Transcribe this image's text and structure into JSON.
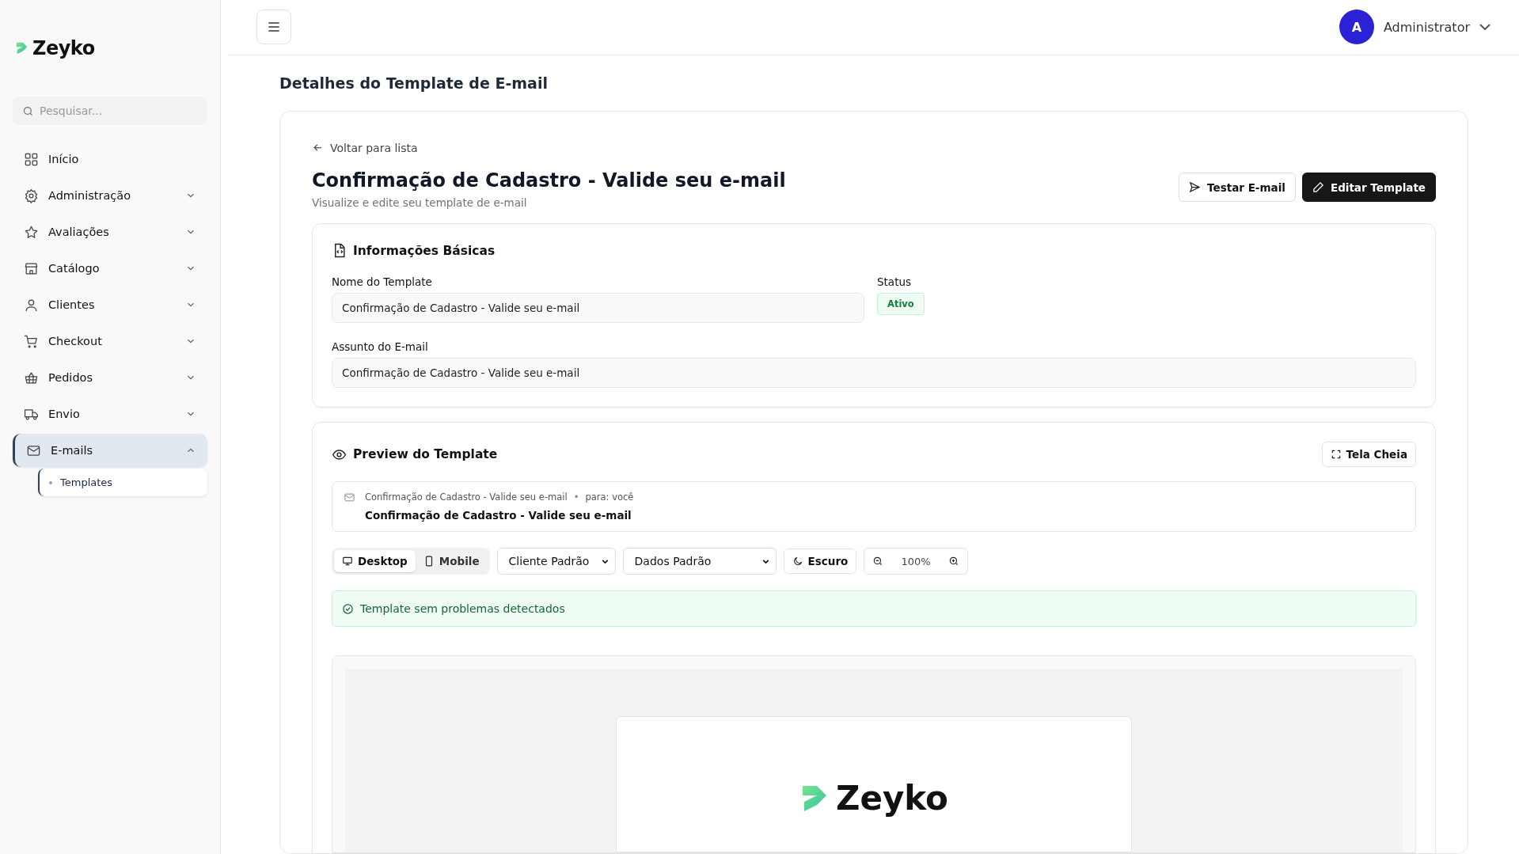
{
  "sidebar": {
    "logo": "Zeyko",
    "search": {
      "placeholder": "Pesquisar..."
    },
    "items": [
      {
        "label": "Início",
        "expandable": false,
        "selected": false
      },
      {
        "label": "Administração",
        "expandable": true,
        "expanded": false,
        "selected": false
      },
      {
        "label": "Avaliações",
        "expandable": true,
        "expanded": false,
        "selected": false
      },
      {
        "label": "Catálogo",
        "expandable": true,
        "expanded": false,
        "selected": false
      },
      {
        "label": "Clientes",
        "expandable": true,
        "expanded": false,
        "selected": false
      },
      {
        "label": "Checkout",
        "expandable": true,
        "expanded": false,
        "selected": false
      },
      {
        "label": "Pedidos",
        "expandable": true,
        "expanded": false,
        "selected": false
      },
      {
        "label": "Envio",
        "expandable": true,
        "expanded": false,
        "selected": false
      },
      {
        "label": "E-mails",
        "expandable": true,
        "expanded": true,
        "selected": true,
        "children": [
          {
            "label": "Templates",
            "selected": true
          }
        ]
      }
    ]
  },
  "header": {
    "user": {
      "initial": "A",
      "name": "Administrator"
    }
  },
  "page_title": "Detalhes do Template de E-mail",
  "detail": {
    "back_link": "Voltar para lista",
    "title": "Confirmação de Cadastro - Valide seu e-mail",
    "subtitle": "Visualize e edite seu template de e-mail",
    "actions": [
      {
        "label": "Testar E-mail",
        "kind": "outline"
      },
      {
        "label": "Editar Template",
        "kind": "primary"
      }
    ]
  },
  "basic_info": {
    "heading": "Informações Básicas",
    "name_label": "Nome do Template",
    "name_value": "Confirmação de Cadastro - Valide seu e-mail",
    "status_label": "Status",
    "status_value": "Ativo",
    "subject_label": "Assunto do E-mail",
    "subject_value": "Confirmação de Cadastro - Valide seu e-mail"
  },
  "preview": {
    "heading": "Preview do Template",
    "fullscreen_button": "Tela Cheia",
    "email_header": {
      "subject": "Confirmação de Cadastro - Valide seu e-mail",
      "separator": "•",
      "recipient": "para: você",
      "title": "Confirmação de Cadastro - Valide seu e-mail"
    },
    "view_modes": [
      {
        "label": "Desktop",
        "selected": true
      },
      {
        "label": "Mobile",
        "selected": false
      }
    ],
    "client_select": "Cliente Padrão",
    "data_select": "Dados Padrão",
    "theme_button": "Escuro",
    "zoom": "100%",
    "validation": "Template sem problemas detectados",
    "email_logo": "Zeyko"
  }
}
